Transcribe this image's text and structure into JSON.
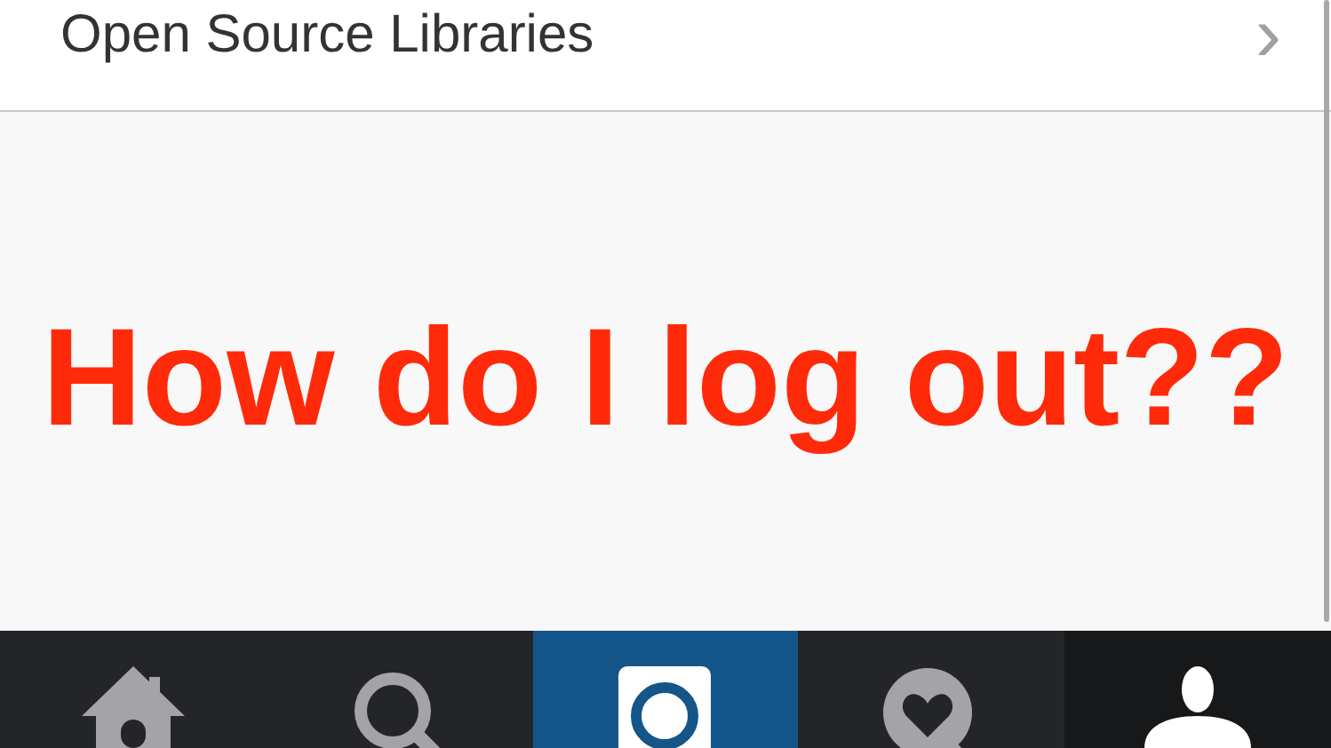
{
  "settings_row": {
    "label": "Open Source Libraries",
    "chevron": "›"
  },
  "message": "How do I log out??",
  "tab_bar": [
    {
      "kind": "home",
      "selected": false
    },
    {
      "kind": "search",
      "selected": false
    },
    {
      "kind": "camera",
      "selected": false
    },
    {
      "kind": "activity",
      "selected": false
    },
    {
      "kind": "profile",
      "selected": true
    }
  ]
}
